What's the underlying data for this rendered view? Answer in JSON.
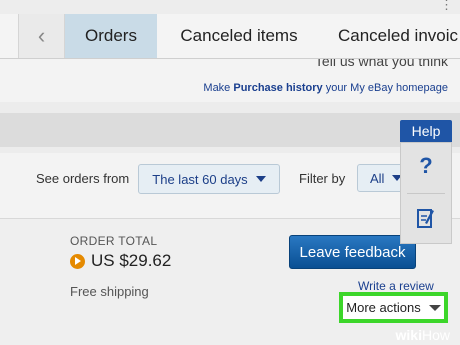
{
  "tabs": [
    {
      "label": "Orders"
    },
    {
      "label": "Canceled items"
    },
    {
      "label": "Canceled invoic"
    }
  ],
  "header": {
    "tell_us": "Tell us what you think",
    "homepage_prefix": "Make ",
    "homepage_bold": "Purchase history",
    "homepage_suffix": " your My eBay homepage"
  },
  "filters": {
    "see_orders_label": "See orders from",
    "date_range_value": "The last 60 days",
    "filter_label": "Filter by",
    "filter_value": "All"
  },
  "order": {
    "total_label": "ORDER TOTAL",
    "amount": "US $29.62",
    "shipping": "Free shipping",
    "leave_feedback": "Leave feedback",
    "write_review": "Write a review",
    "more_actions": "More actions"
  },
  "help": {
    "tab_label": "Help",
    "question_icon": "?"
  },
  "watermark": {
    "brand_bold": "wiki",
    "brand_normal": "How"
  },
  "colors": {
    "active_tab": "#c9dbe7",
    "primary_button": "#0b5ca6",
    "highlight_border": "#3cd62a",
    "link": "#1a3f8f",
    "help_blue": "#1f55a6"
  }
}
